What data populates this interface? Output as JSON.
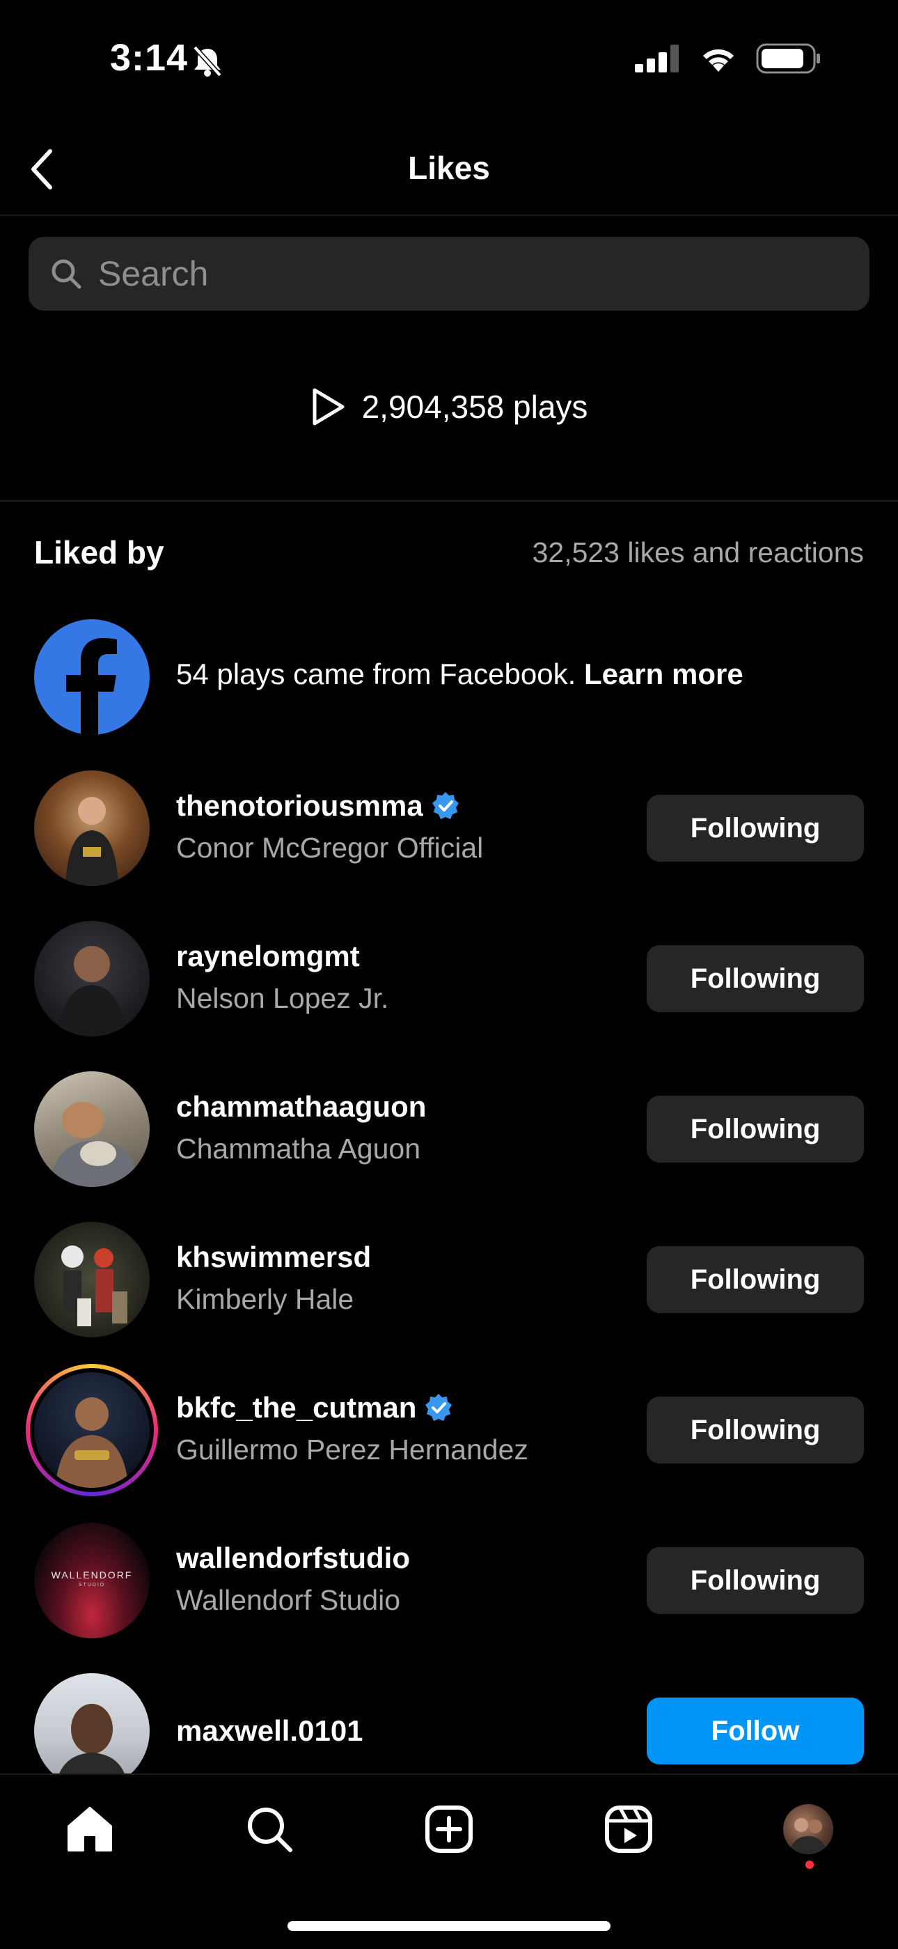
{
  "status_bar": {
    "time": "3:14"
  },
  "header": {
    "title": "Likes"
  },
  "search": {
    "placeholder": "Search"
  },
  "plays": {
    "text": "2,904,358 plays"
  },
  "liked_by": {
    "label": "Liked by",
    "count": "32,523 likes and reactions"
  },
  "facebook": {
    "text": "54 plays came from Facebook.",
    "link": "Learn more",
    "brand_color": "#3578e5"
  },
  "users": [
    {
      "username": "thenotoriousmma",
      "full_name": "Conor McGregor Official",
      "verified": true,
      "button": "Following"
    },
    {
      "username": "raynelomgmt",
      "full_name": "Nelson Lopez Jr.",
      "verified": false,
      "button": "Following"
    },
    {
      "username": "chammathaaguon",
      "full_name": "Chammatha Aguon",
      "verified": false,
      "button": "Following"
    },
    {
      "username": "khswimmersd",
      "full_name": "Kimberly Hale",
      "verified": false,
      "button": "Following"
    },
    {
      "username": "bkfc_the_cutman",
      "full_name": "Guillermo Perez Hernandez",
      "verified": true,
      "has_story": true,
      "button": "Following"
    },
    {
      "username": "wallendorfstudio",
      "full_name": "Wallendorf Studio",
      "verified": false,
      "button": "Following",
      "avatar_text": "WALLENDORF",
      "avatar_subtext": "STUDIO"
    },
    {
      "username": "maxwell.0101",
      "full_name": "",
      "verified": false,
      "button": "Follow"
    }
  ],
  "colors": {
    "follow_blue": "#0095f6",
    "verified_blue": "#3897f0",
    "button_gray": "#262626",
    "secondary_text": "#a8a8a8"
  },
  "nav": [
    "home-icon",
    "search-icon",
    "create-icon",
    "reels-icon",
    "profile-avatar"
  ]
}
